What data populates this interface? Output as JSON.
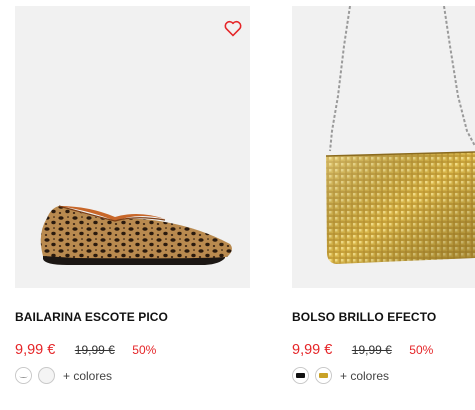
{
  "products": [
    {
      "name": "BAILARINA ESCOTE PICO",
      "price": "9,99 €",
      "old_price": "19,99 €",
      "discount": "50%",
      "more_colors": "+ colores",
      "favorite_icon": "heart-icon",
      "image": "leopard-print-flat-shoe",
      "swatch_colors": [
        "#ffffff",
        "#f4f4f4"
      ]
    },
    {
      "name": "BOLSO BRILLO EFECTO",
      "price": "9,99 €",
      "old_price": "19,99 €",
      "discount": "50%",
      "more_colors": "+ colores",
      "image": "gold-sequin-chain-bag",
      "swatch_colors": [
        "#111111",
        "#c9a227"
      ]
    }
  ],
  "colors": {
    "accent": "#e52528",
    "text": "#111111",
    "image_bg": "#f1f1f1"
  }
}
